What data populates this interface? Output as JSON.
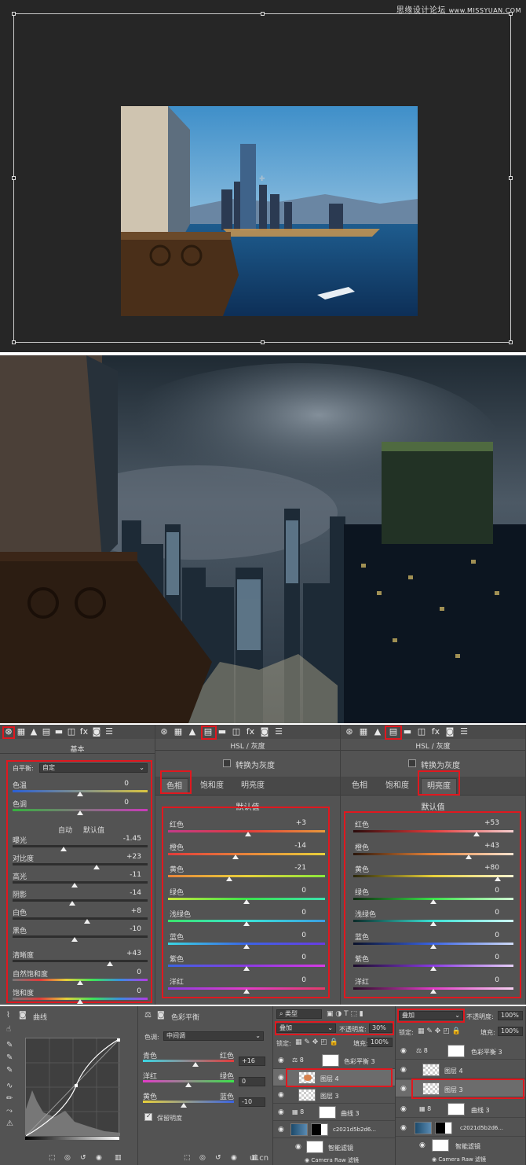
{
  "watermark": {
    "text": "思缘设计论坛",
    "url": "www.MISSYUAN.COM"
  },
  "colors": {
    "accent_red": "#e0181f",
    "panel_bg": "#535353",
    "canvas_bg": "#262626"
  },
  "basic_panel": {
    "title": "基本",
    "wb_label": "白平衡:",
    "wb_value": "自定",
    "temp": {
      "label": "色温",
      "value": "0"
    },
    "tint": {
      "label": "色调",
      "value": "0"
    },
    "auto": "自动",
    "default": "默认值",
    "sliders": [
      {
        "label": "曝光",
        "value": "-1.45",
        "pos": 0.38
      },
      {
        "label": "对比度",
        "value": "+23",
        "pos": 0.62
      },
      {
        "label": "高光",
        "value": "-11",
        "pos": 0.46
      },
      {
        "label": "阴影",
        "value": "-14",
        "pos": 0.44
      },
      {
        "label": "白色",
        "value": "+8",
        "pos": 0.55
      },
      {
        "label": "黑色",
        "value": "-10",
        "pos": 0.46
      }
    ],
    "sliders2": [
      {
        "label": "清晰度",
        "value": "+43",
        "pos": 0.72
      },
      {
        "label": "自然饱和度",
        "value": "0",
        "pos": 0.5
      },
      {
        "label": "饱和度",
        "value": "0",
        "pos": 0.5
      }
    ]
  },
  "hsl_hue": {
    "title": "HSL / 灰度",
    "gray": "转换为灰度",
    "tabs": [
      "色相",
      "饱和度",
      "明亮度"
    ],
    "sub": "默认值",
    "rows": [
      {
        "label": "红色",
        "value": "+3",
        "pos": 0.51
      },
      {
        "label": "橙色",
        "value": "-14",
        "pos": 0.43
      },
      {
        "label": "黄色",
        "value": "-21",
        "pos": 0.39
      },
      {
        "label": "绿色",
        "value": "0",
        "pos": 0.5
      },
      {
        "label": "浅绿色",
        "value": "0",
        "pos": 0.5
      },
      {
        "label": "蓝色",
        "value": "0",
        "pos": 0.5
      },
      {
        "label": "紫色",
        "value": "0",
        "pos": 0.5
      },
      {
        "label": "洋红",
        "value": "0",
        "pos": 0.5
      }
    ]
  },
  "hsl_lum": {
    "title": "HSL / 灰度",
    "gray": "转换为灰度",
    "tabs": [
      "色相",
      "饱和度",
      "明亮度"
    ],
    "sub": "默认值",
    "rows": [
      {
        "label": "红色",
        "value": "+53",
        "pos": 0.77
      },
      {
        "label": "橙色",
        "value": "+43",
        "pos": 0.72
      },
      {
        "label": "黄色",
        "value": "+80",
        "pos": 0.9
      },
      {
        "label": "绿色",
        "value": "0",
        "pos": 0.5
      },
      {
        "label": "浅绿色",
        "value": "0",
        "pos": 0.5
      },
      {
        "label": "蓝色",
        "value": "0",
        "pos": 0.5
      },
      {
        "label": "紫色",
        "value": "0",
        "pos": 0.5
      },
      {
        "label": "洋红",
        "value": "0",
        "pos": 0.5
      }
    ]
  },
  "curves": {
    "title": "曲线"
  },
  "color_balance": {
    "title": "色彩平衡",
    "tone_label": "色调:",
    "tone_value": "中间调",
    "rows": [
      {
        "left": "青色",
        "right": "红色",
        "value": "+16",
        "pos": 0.58
      },
      {
        "left": "洋红",
        "right": "绿色",
        "value": "0",
        "pos": 0.5
      },
      {
        "left": "黄色",
        "right": "蓝色",
        "value": "-10",
        "pos": 0.45
      }
    ],
    "preserve": "保留明度"
  },
  "layers_a": {
    "filter": "类型",
    "blend": "叠加",
    "opacity_label": "不透明度:",
    "opacity": "30%",
    "lock": "锁定:",
    "fill_label": "填充:",
    "fill": "100%",
    "items": [
      "色彩平衡 3",
      "图层 4",
      "图层 3",
      "曲线 3",
      "c2021d5b2d6...",
      "智能滤镜",
      "Camera Raw 滤镜"
    ]
  },
  "layers_b": {
    "blend": "叠加",
    "opacity_label": "不透明度:",
    "opacity": "100%",
    "lock": "锁定:",
    "fill_label": "填充:",
    "fill": "100%",
    "items": [
      "色彩平衡 3",
      "图层 4",
      "图层 3",
      "曲线 3",
      "c2021d5b2d6...",
      "智能滤镜",
      "Camera Raw 滤镜"
    ]
  },
  "footer_mark": "ui.cn"
}
